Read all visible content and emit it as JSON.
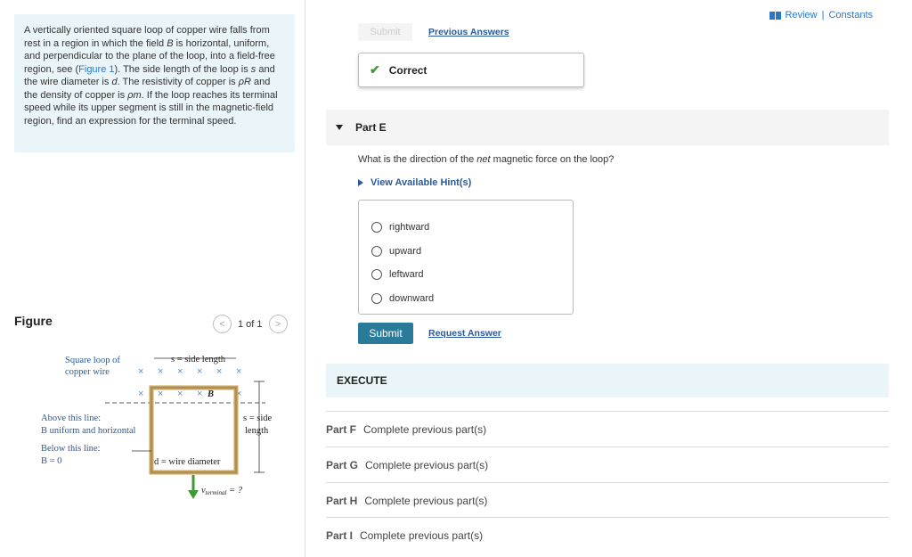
{
  "problem": {
    "text_before_link": "A vertically oriented square loop of copper wire falls from rest in a region in which the field ",
    "field_symbol": "B",
    "text_mid": " is horizontal, uniform, and perpendicular to the plane of the loop, into a field-free region, see (",
    "link_text": "Figure 1",
    "text_after_link": "). The side length of the loop is ",
    "s_symbol": "s",
    "text_2": " and the wire diameter is ",
    "d_symbol": "d",
    "text_3": ". The resistivity of copper is ",
    "rhoR_symbol": "ρR",
    "text_4": " and the density of copper is ",
    "rhom_symbol": "ρm",
    "text_5": ". If the loop reaches its terminal speed while its upper segment is still in the magnetic-field region, find an expression for the terminal speed."
  },
  "figure": {
    "label": "Figure",
    "pager": "1 of 1",
    "prev_icon": "chevron-left-icon",
    "next_icon": "chevron-right-icon",
    "annotations": {
      "loop_label_1": "Square loop of",
      "loop_label_2": "copper wire",
      "side_length": "s = side length",
      "field": "B",
      "side_right_1": "s = side",
      "side_right_2": "length",
      "above_1": "Above this line:",
      "above_2": "B uniform and horizontal",
      "below_1": "Below this line:",
      "below_2": "B = 0",
      "diameter": "d = wire diameter",
      "terminal": "v",
      "terminal_sub": "terminal",
      "terminal_suffix": " = ?"
    }
  },
  "header": {
    "review": "Review",
    "separator": "|",
    "constants": "Constants"
  },
  "part_d": {
    "submit_label": "Submit",
    "previous_answers": "Previous Answers",
    "correct_label": "Correct"
  },
  "part_e": {
    "title": "Part E",
    "question_prefix": "What is the direction of the ",
    "question_em": "net",
    "question_suffix": " magnetic force on the loop?",
    "hints": "View Available Hint(s)",
    "options": [
      "rightward",
      "upward",
      "leftward",
      "downward"
    ],
    "submit_label": "Submit",
    "request_answer": "Request Answer"
  },
  "execute_label": "EXECUTE",
  "locked_parts": [
    {
      "label": "Part F",
      "status": "Complete previous part(s)"
    },
    {
      "label": "Part G",
      "status": "Complete previous part(s)"
    },
    {
      "label": "Part H",
      "status": "Complete previous part(s)"
    },
    {
      "label": "Part I",
      "status": "Complete previous part(s)"
    }
  ],
  "colors": {
    "accent_blue": "#2a77c5",
    "submit_blue": "#2a7a9a",
    "correct_green": "#3d9a34",
    "panel_tint": "#e9f5f8",
    "loop_copper": "#c8a460",
    "arrow_green": "#3d9a34"
  }
}
